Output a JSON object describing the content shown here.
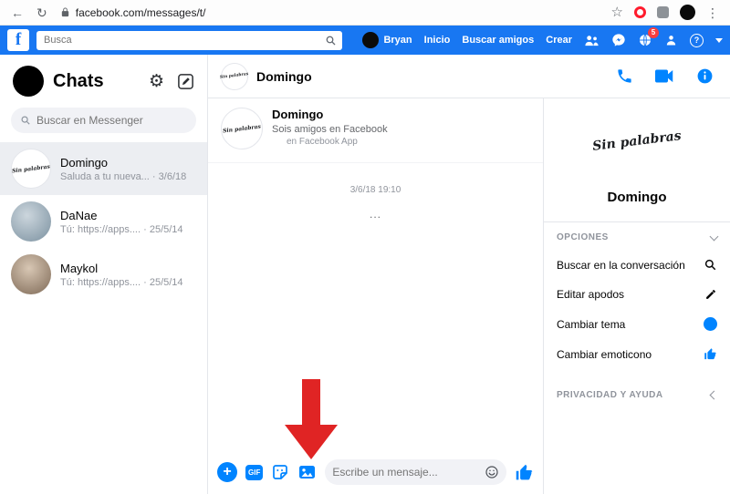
{
  "browser": {
    "url": "facebook.com/messages/t/"
  },
  "icons": {
    "back": "←",
    "refresh": "↻",
    "star": "☆",
    "menu": "⋮",
    "gear": "⚙",
    "help": "?",
    "plus": "+"
  },
  "ui": {
    "dot": "·"
  },
  "navbar": {
    "logo_letter": "f",
    "search_placeholder": "Busca",
    "profile_name": "Bryan",
    "links": {
      "home": "Inicio",
      "find_friends": "Buscar amigos",
      "create": "Crear"
    },
    "notification_count": "5"
  },
  "chats_panel": {
    "title": "Chats",
    "search_placeholder": "Buscar en Messenger",
    "conversations": [
      {
        "name": "Domingo",
        "avatar_text": "Sin palabras",
        "preview": "Saluda a tu nueva...",
        "time": "3/6/18"
      },
      {
        "name": "DaNae",
        "preview": "Tú: https://apps....",
        "time": "25/5/14"
      },
      {
        "name": "Maykol",
        "preview": "Tú: https://apps....",
        "time": "25/5/14"
      }
    ]
  },
  "conversation": {
    "header": {
      "avatar_text": "Sin palabras",
      "name": "Domingo"
    },
    "intro": {
      "avatar_text": "Sin palabras",
      "name": "Domingo",
      "friends_line": "Sois amigos en Facebook",
      "app_line": "en Facebook App"
    },
    "timestamp": "3/6/18 19:10",
    "ellipsis_message": "...",
    "composer": {
      "placeholder": "Escribe un mensaje...",
      "gif_label": "GIF"
    }
  },
  "details_panel": {
    "avatar_text": "Sin palabras",
    "name": "Domingo",
    "options_header": "OPCIONES",
    "options": [
      {
        "label": "Buscar en la conversación"
      },
      {
        "label": "Editar apodos"
      },
      {
        "label": "Cambiar tema"
      },
      {
        "label": "Cambiar emoticono"
      }
    ],
    "privacy_header": "PRIVACIDAD Y AYUDA"
  },
  "colors": {
    "facebook_blue": "#1877f2",
    "messenger_blue": "#0084ff",
    "arrow_red": "#e02424",
    "badge_red": "#fa3e3e"
  }
}
